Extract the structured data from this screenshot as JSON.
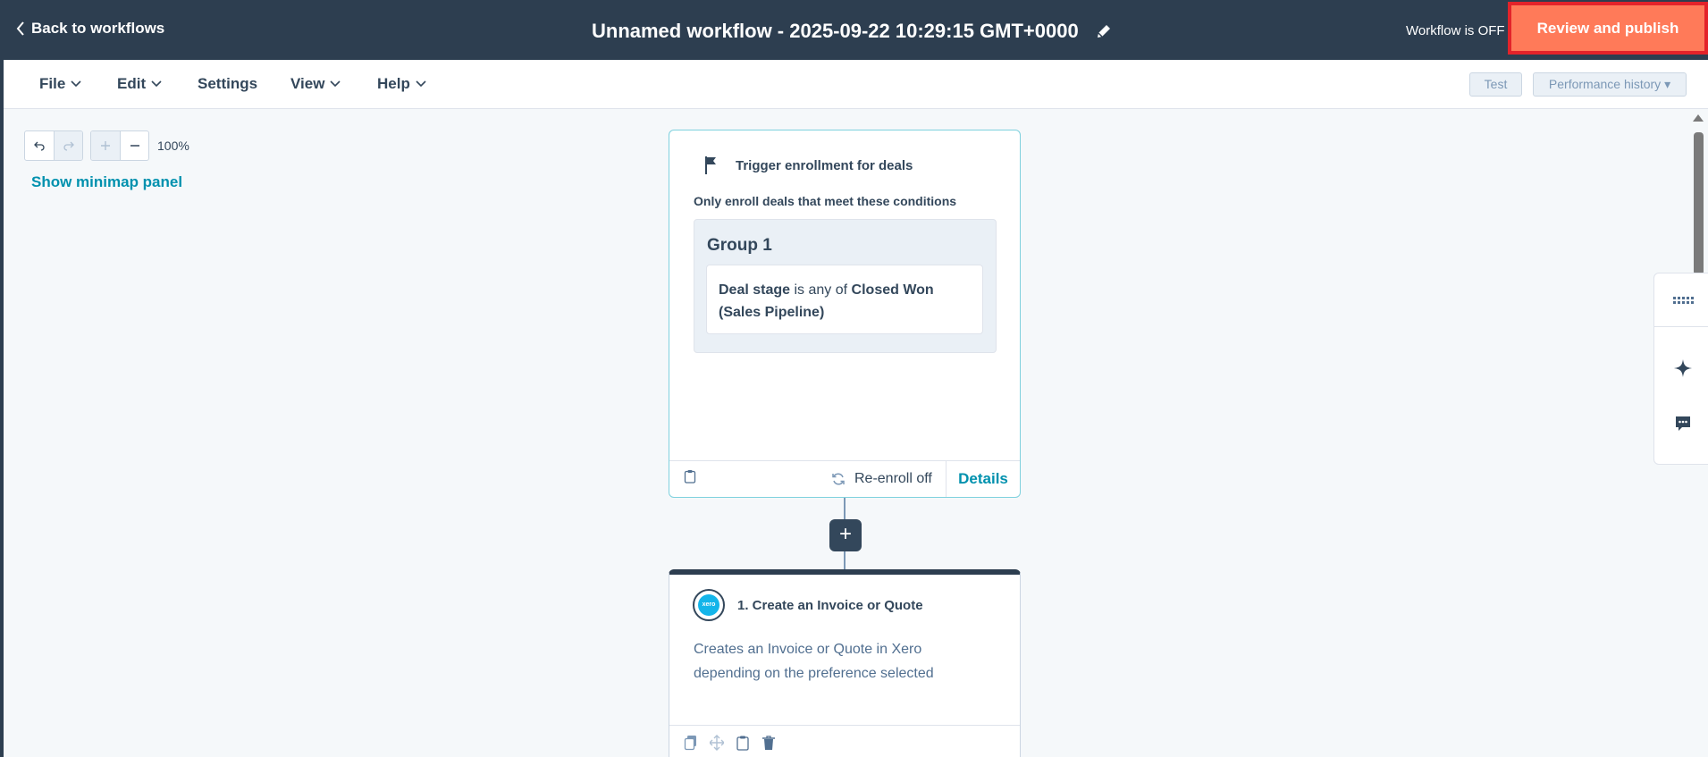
{
  "header": {
    "back_label": "Back to workflows",
    "title": "Unnamed workflow - 2025-09-22 10:29:15 GMT+0000",
    "status": "Workflow is OFF",
    "publish_label": "Review and publish"
  },
  "menubar": {
    "file": "File",
    "edit": "Edit",
    "settings": "Settings",
    "view": "View",
    "help": "Help",
    "test": "Test",
    "performance_history": "Performance history ▾"
  },
  "canvas": {
    "zoom": "100%",
    "minimap_link": "Show minimap panel"
  },
  "trigger": {
    "title": "Trigger enrollment for deals",
    "subtitle": "Only enroll deals that meet these conditions",
    "group_title": "Group 1",
    "condition": {
      "property": "Deal stage",
      "operator": "is any of",
      "value": "Closed Won (Sales Pipeline)"
    },
    "reenroll": "Re-enroll off",
    "details": "Details"
  },
  "action": {
    "title": "1. Create an Invoice or Quote",
    "description": "Creates an Invoice or Quote in Xero depending on the preference selected",
    "logo_text": "xero"
  },
  "colors": {
    "header_bg": "#2d3e50",
    "publish_bg": "#ff7a59",
    "highlight_border": "#e3232a",
    "link": "#0091ae",
    "trigger_border": "#7fd1de"
  }
}
